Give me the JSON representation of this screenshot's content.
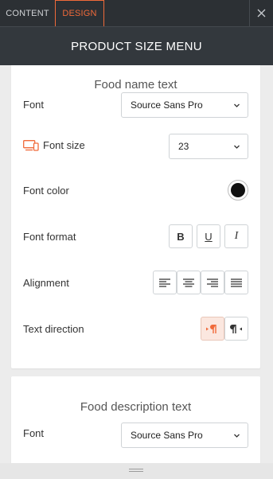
{
  "tabs": [
    {
      "label": "CONTENT",
      "active": false
    },
    {
      "label": "DESIGN",
      "active": true
    }
  ],
  "header": {
    "title": "PRODUCT SIZE MENU"
  },
  "colors": {
    "accent": "#f06a3a",
    "header_bg": "#33383d",
    "tabs_bg": "#2c3034",
    "font_color_swatch": "#111111"
  },
  "section_name": {
    "title": "Food name text",
    "font_label": "Font",
    "font_value": "Source Sans Pro",
    "font_size_label": "Font size",
    "font_size_icon": "devices-icon",
    "font_size_value": "23",
    "font_color_label": "Font color",
    "font_format_label": "Font format",
    "format_buttons": {
      "bold": "B",
      "underline": "U",
      "italic": "I"
    },
    "alignment_label": "Alignment",
    "text_direction_label": "Text direction",
    "text_direction_selected": "ltr"
  },
  "section_description": {
    "title": "Food description text",
    "font_label": "Font",
    "font_value": "Source Sans Pro"
  }
}
